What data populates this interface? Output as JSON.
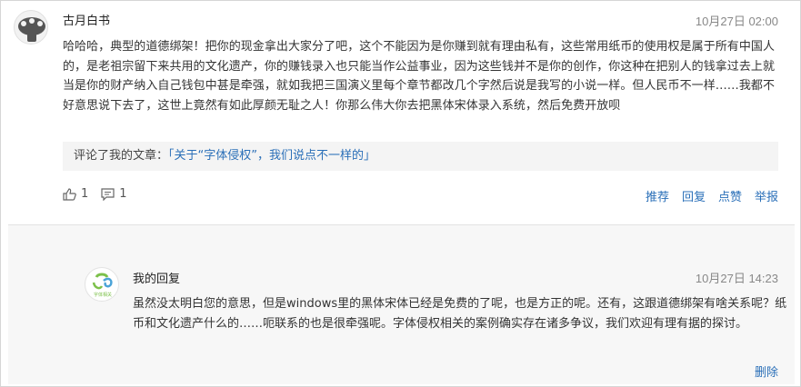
{
  "comment": {
    "username": "古月白书",
    "time": "10月27日 02:00",
    "content": "哈哈哈，典型的道德绑架！把你的现金拿出大家分了吧，这个不能因为是你赚到就有理由私有，这些常用纸币的使用权是属于所有中国人的，是老祖宗留下来共用的文化遗产，你的赚钱录入也只能当作公益事业，因为这些钱并不是你的创作，你这种在把别人的钱拿过去上就当是你的财产纳入自己钱包中甚是牵强，就如我把三国演义里每个章节都改几个字然后说是我写的小说一样。但人民币不一样……我都不好意思说下去了，这世上竟然有如此厚颜无耻之人！你那么伟大你去把黑体宋体录入系统，然后免费开放呗",
    "quote_prefix": "评论了我的文章：",
    "quote_link": "「关于“字体侵权”，我们说点不一样的」",
    "likes": "1",
    "replies": "1",
    "actions": {
      "recommend": "推荐",
      "reply": "回复",
      "like": "点赞",
      "report": "举报"
    }
  },
  "reply": {
    "author": "我的回复",
    "time": "10月27日 14:23",
    "content": "虽然没太明白您的意思，但是windows里的黑体宋体已经是免费的了呢，也是方正的呢。还有，这跟道德绑架有啥关系呢？纸币和文化遗产什么的……呃联系的也是很牵强呢。字体侵权相关的案例确实存在诸多争议，我们欢迎有理有据的探讨。",
    "delete_label": "删除",
    "avatar_text": "字体相关"
  }
}
